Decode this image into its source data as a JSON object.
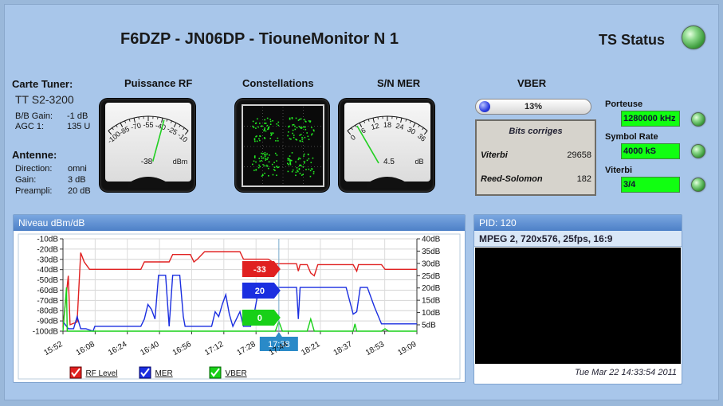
{
  "header": {
    "title": "F6DZP - JN06DP - TiouneMonitor N 1",
    "ts_status_label": "TS Status"
  },
  "tuner": {
    "heading": "Carte Tuner:",
    "model": "TT S2-3200",
    "bb_gain_label": "B/B Gain:",
    "bb_gain_value": "-1 dB",
    "agc_label": "AGC 1:",
    "agc_value": "135 U"
  },
  "antenna": {
    "heading": "Antenne:",
    "direction_label": "Direction:",
    "direction_value": "omni",
    "gain_label": "Gain:",
    "gain_value": "3 dB",
    "preampli_label": "Preampli:",
    "preampli_value": "20 dB"
  },
  "meters": {
    "rf": {
      "label": "Puissance RF",
      "ticks": [
        "-100",
        "-85",
        "-70",
        "-55",
        "-40",
        "-25",
        "-10"
      ],
      "value_text": "-38",
      "unit": "dBm",
      "value": -38,
      "range": [
        -100,
        -10
      ]
    },
    "constellation": {
      "label": "Constellations"
    },
    "mer": {
      "label": "S/N MER",
      "ticks": [
        "0",
        "6",
        "12",
        "18",
        "24",
        "30",
        "36"
      ],
      "value_text": "4.5",
      "unit": "dB",
      "value": 4.5,
      "range": [
        0,
        36
      ]
    }
  },
  "vber": {
    "label": "VBER",
    "percent_text": "13%",
    "percent": 13,
    "bits_title": "Bits corriges",
    "viterbi_label": "Viterbi",
    "viterbi_value": "29658",
    "rs_label": "Reed-Solomon",
    "rs_value": "182"
  },
  "status": {
    "porteuse_label": "Porteuse",
    "porteuse_value": "1280000 kHz",
    "symbol_rate_label": "Symbol Rate",
    "symbol_rate_value": "4000 kS",
    "viterbi_label": "Viterbi",
    "viterbi_value": "3/4"
  },
  "chart_panel": {
    "title": "Niveau dBm/dB"
  },
  "chart_data": {
    "type": "line",
    "x_ticks": [
      "15:52",
      "16:08",
      "16:24",
      "16:40",
      "16:56",
      "17:12",
      "17:28",
      "17:44",
      "18:21",
      "18:37",
      "18:53",
      "19:09"
    ],
    "left_axis": {
      "ticks": [
        "-10dB",
        "-20dB",
        "-30dB",
        "-40dB",
        "-50dB",
        "-60dB",
        "-70dB",
        "-80dB",
        "-90dB",
        "-100dB"
      ],
      "range": [
        -105,
        -5
      ]
    },
    "right_axis": {
      "ticks": [
        "40dB",
        "35dB",
        "30dB",
        "25dB",
        "20dB",
        "15dB",
        "10dB",
        "5dB"
      ],
      "range": [
        2,
        40
      ]
    },
    "cursor_time": "17:38",
    "cursor_labels": {
      "rf": "-33",
      "mer": "20",
      "vber": "0"
    },
    "colors": {
      "rf": "#e02020",
      "mer": "#1a2ee0",
      "vber": "#18d018",
      "cursor_time_bg": "#2a8ac8"
    },
    "series": [
      {
        "name": "RF Level",
        "axis": "left",
        "color": "#e02020",
        "points": [
          [
            0,
            -100
          ],
          [
            0.015,
            -45
          ],
          [
            0.02,
            -98
          ],
          [
            0.04,
            -95
          ],
          [
            0.05,
            -20
          ],
          [
            0.06,
            -30
          ],
          [
            0.075,
            -38
          ],
          [
            0.22,
            -38
          ],
          [
            0.23,
            -30
          ],
          [
            0.3,
            -30
          ],
          [
            0.31,
            -22
          ],
          [
            0.36,
            -22
          ],
          [
            0.37,
            -30
          ],
          [
            0.38,
            -27
          ],
          [
            0.4,
            -19
          ],
          [
            0.5,
            -19
          ],
          [
            0.51,
            -27
          ],
          [
            0.58,
            -27
          ],
          [
            0.6,
            -32
          ],
          [
            0.66,
            -32
          ],
          [
            0.665,
            -40
          ],
          [
            0.67,
            -33
          ],
          [
            0.69,
            -33
          ],
          [
            0.7,
            -42
          ],
          [
            0.71,
            -45
          ],
          [
            0.72,
            -33
          ],
          [
            0.82,
            -33
          ],
          [
            0.83,
            -40
          ],
          [
            0.835,
            -33
          ],
          [
            0.9,
            -33
          ],
          [
            0.91,
            -38
          ],
          [
            1,
            -38
          ]
        ]
      },
      {
        "name": "MER",
        "axis": "right",
        "color": "#1a2ee0",
        "points": [
          [
            0,
            6
          ],
          [
            0.015,
            3
          ],
          [
            0.03,
            3
          ],
          [
            0.04,
            8
          ],
          [
            0.05,
            3
          ],
          [
            0.065,
            3
          ],
          [
            0.085,
            2
          ],
          [
            0.09,
            4
          ],
          [
            0.22,
            4
          ],
          [
            0.23,
            7
          ],
          [
            0.24,
            13
          ],
          [
            0.25,
            11
          ],
          [
            0.26,
            7
          ],
          [
            0.27,
            25
          ],
          [
            0.29,
            25
          ],
          [
            0.3,
            4
          ],
          [
            0.31,
            25
          ],
          [
            0.33,
            25
          ],
          [
            0.34,
            8
          ],
          [
            0.345,
            4
          ],
          [
            0.42,
            4
          ],
          [
            0.43,
            10
          ],
          [
            0.44,
            8
          ],
          [
            0.45,
            13
          ],
          [
            0.46,
            17
          ],
          [
            0.47,
            9
          ],
          [
            0.48,
            4
          ],
          [
            0.5,
            10
          ],
          [
            0.51,
            4
          ],
          [
            0.53,
            4
          ],
          [
            0.54,
            9
          ],
          [
            0.55,
            17
          ],
          [
            0.56,
            19
          ],
          [
            0.57,
            20
          ],
          [
            0.58,
            20
          ],
          [
            0.6,
            20
          ],
          [
            0.62,
            20
          ],
          [
            0.64,
            20
          ],
          [
            0.66,
            20
          ],
          [
            0.665,
            7
          ],
          [
            0.67,
            20
          ],
          [
            0.8,
            20
          ],
          [
            0.82,
            9
          ],
          [
            0.83,
            10
          ],
          [
            0.84,
            20
          ],
          [
            0.86,
            20
          ],
          [
            0.88,
            12
          ],
          [
            0.9,
            5
          ],
          [
            1,
            5
          ]
        ]
      },
      {
        "name": "VBER",
        "axis": "right",
        "color": "#18d018",
        "points": [
          [
            0,
            2
          ],
          [
            0.01,
            20
          ],
          [
            0.012,
            2
          ],
          [
            0.2,
            2
          ],
          [
            0.6,
            2
          ],
          [
            0.61,
            6
          ],
          [
            0.62,
            2
          ],
          [
            0.69,
            2
          ],
          [
            0.7,
            7
          ],
          [
            0.71,
            2
          ],
          [
            0.82,
            2
          ],
          [
            0.825,
            5
          ],
          [
            0.83,
            2
          ],
          [
            0.9,
            2
          ],
          [
            0.91,
            3
          ],
          [
            0.92,
            2
          ],
          [
            1,
            2
          ]
        ]
      }
    ]
  },
  "legend": {
    "rf_label": "RF Level",
    "mer_label": "MER",
    "vber_label": "VBER"
  },
  "video_panel": {
    "title": "PID: 120",
    "info": "MPEG 2, 720x576, 25fps, 16:9",
    "timestamp": "Tue Mar 22 14:33:54 2011"
  }
}
